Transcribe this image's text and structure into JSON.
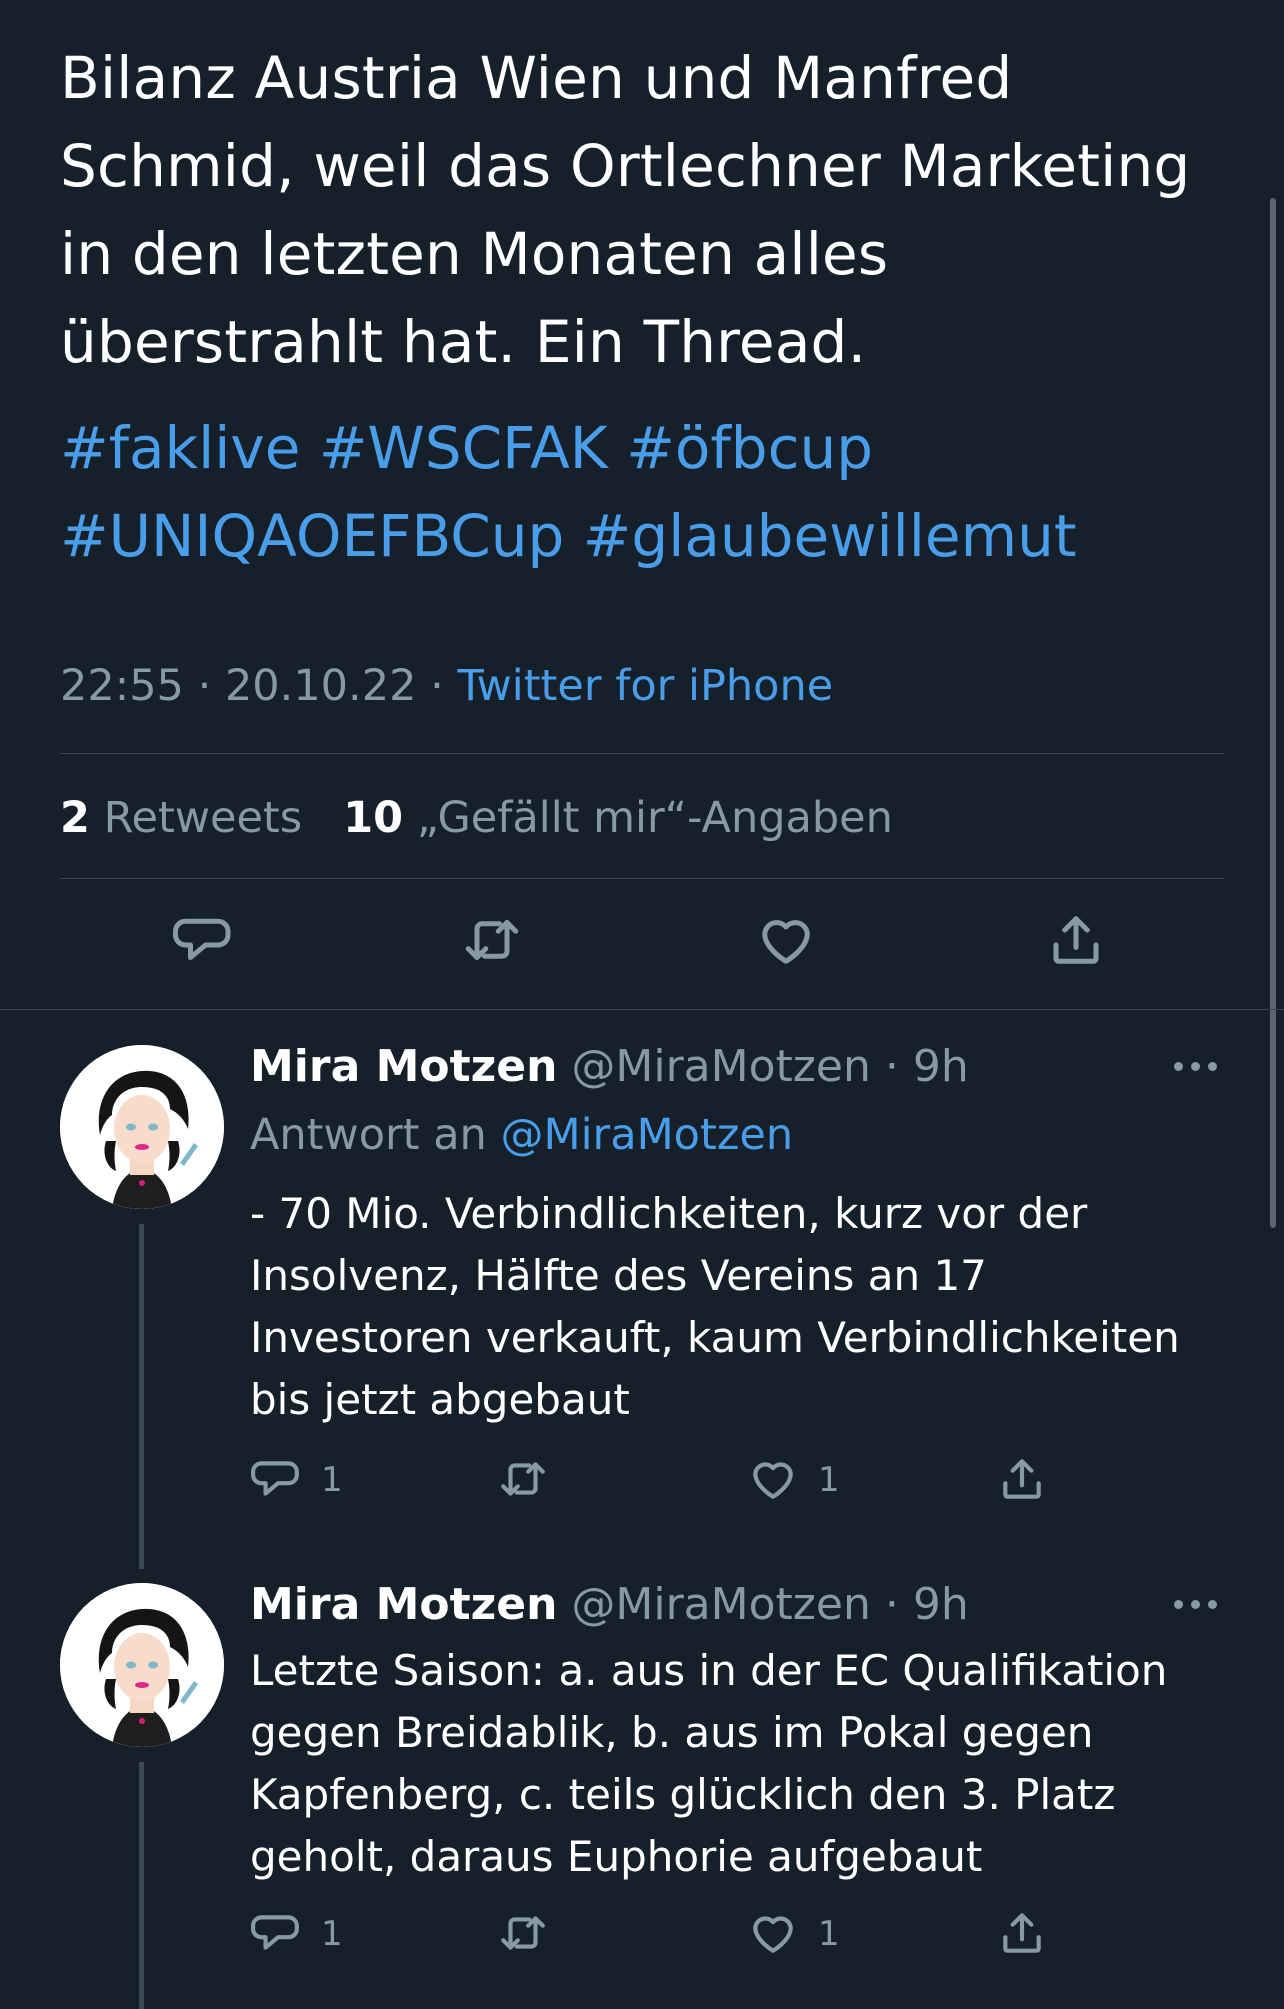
{
  "main_tweet": {
    "text_lines": [
      "Bilanz Austria Wien und Manfred",
      "Schmid, weil das Ortlechner Marketing",
      "in den letzten Monaten alles",
      "überstrahlt hat. Ein Thread."
    ],
    "hashtag_lines": [
      "#faklive #WSCFAK #öfbcup",
      "#UNIQAOEFBCup #glaubewillemut"
    ],
    "time": "22:55",
    "date": "20.10.22",
    "source": "Twitter for iPhone",
    "separator": "·",
    "retweets_count": "2",
    "retweets_label": "Retweets",
    "likes_count": "10",
    "likes_label": "„Gefällt mir“-Angaben"
  },
  "replies": [
    {
      "name": "Mira Motzen",
      "handle": "@MiraMotzen",
      "separator": "·",
      "time": "9h",
      "reply_to_label": "Antwort an",
      "reply_to_handle": "@MiraMotzen",
      "text_lines": [
        "- 70 Mio. Verbindlichkeiten, kurz vor der",
        "Insolvenz, Hälfte des Vereins an 17",
        "Investoren verkauft, kaum Verbindlichkeiten",
        "bis jetzt abgebaut"
      ],
      "reply_count": "1",
      "like_count": "1"
    },
    {
      "name": "Mira Motzen",
      "handle": "@MiraMotzen",
      "separator": "·",
      "time": "9h",
      "text_lines": [
        "Letzte Saison: a. aus in der EC Qualifikation",
        "gegen Breidablik, b. aus im Pokal gegen",
        "Kapfenberg, c. teils glücklich den 3. Platz",
        "geholt, daraus Euphorie aufgebaut"
      ],
      "reply_count": "1",
      "like_count": "1"
    }
  ],
  "icons": {
    "reply": "speech-bubble-icon",
    "retweet": "retweet-arrows-icon",
    "like": "heart-icon",
    "share": "share-upload-icon",
    "more": "more-dots-icon"
  },
  "colors": {
    "background": "#15202b",
    "text": "#ffffff",
    "secondary": "#8899a6",
    "link": "#4a9de8",
    "divider": "#38444d"
  }
}
